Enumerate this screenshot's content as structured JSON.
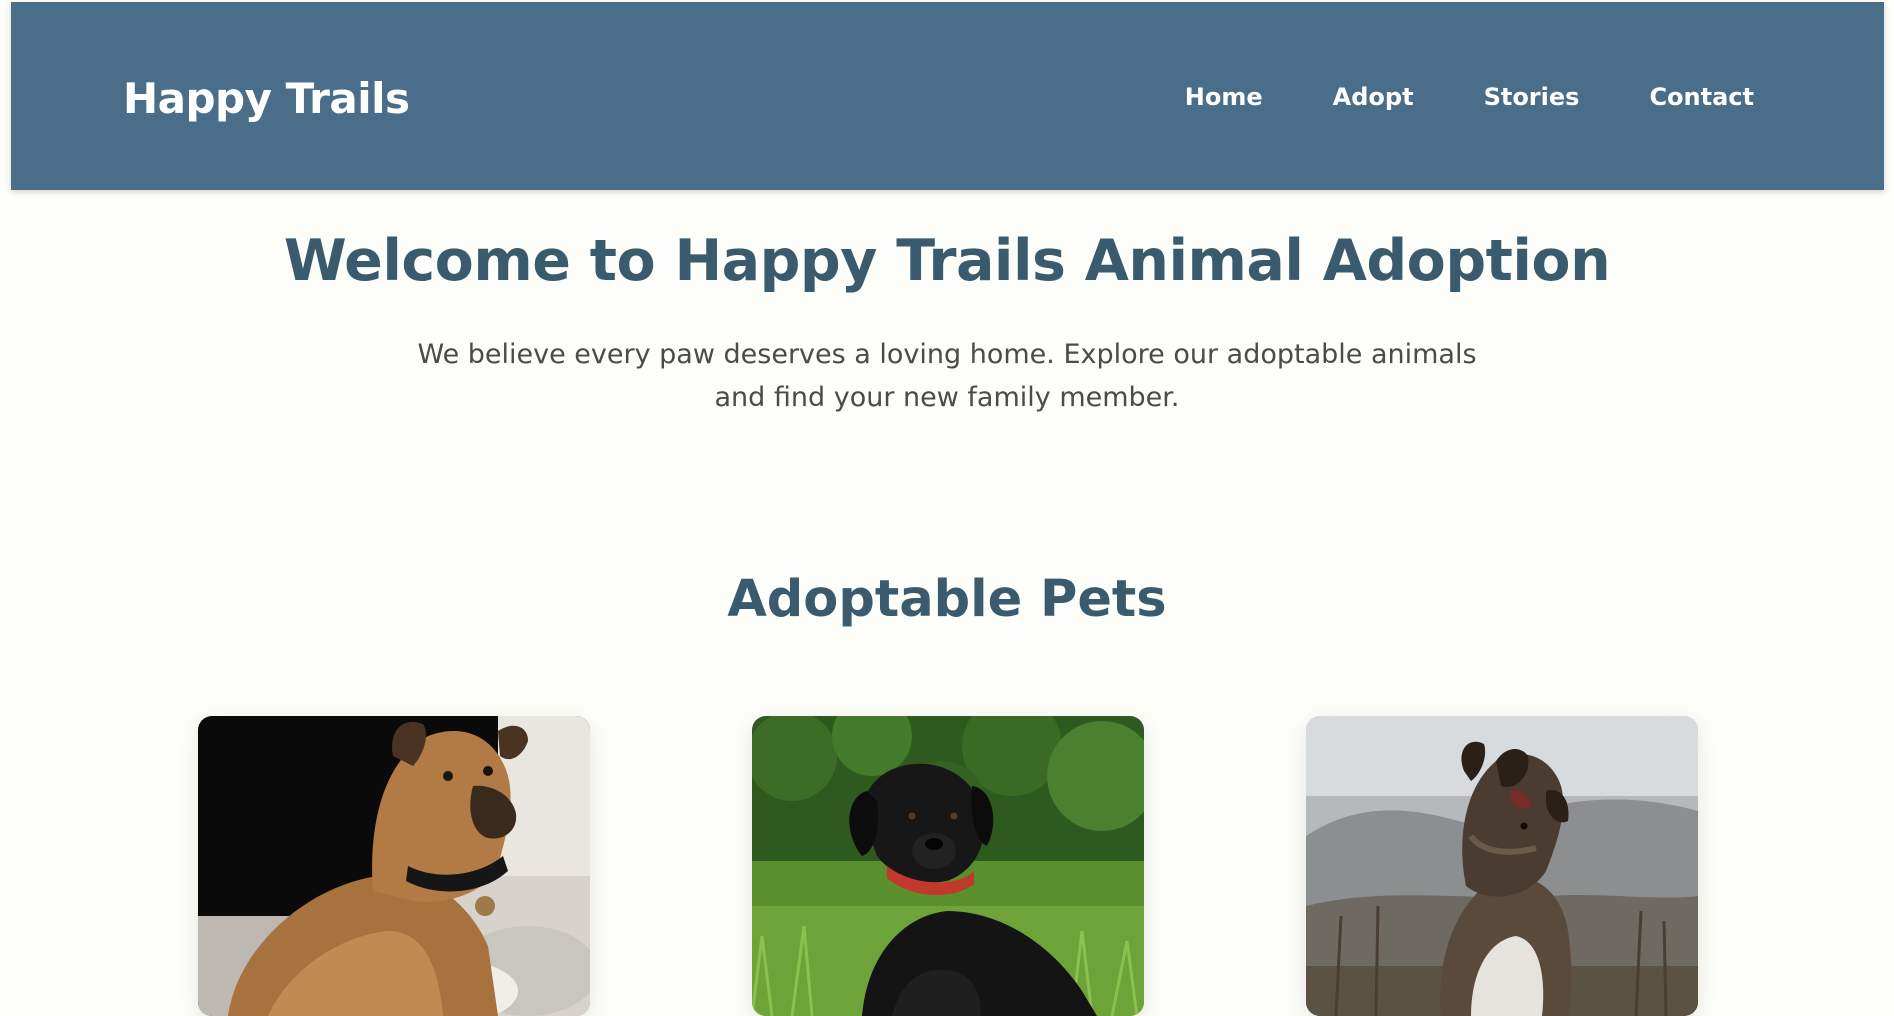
{
  "header": {
    "brand": "Happy Trails",
    "nav": [
      {
        "label": "Home"
      },
      {
        "label": "Adopt"
      },
      {
        "label": "Stories"
      },
      {
        "label": "Contact"
      }
    ]
  },
  "hero": {
    "title": "Welcome to Happy Trails Animal Adoption",
    "subtitle": "We believe every paw deserves a loving home. Explore our adoptable animals and find your new family member."
  },
  "pets_section": {
    "title": "Adoptable Pets",
    "pets": [
      {
        "image": "tan-dog-photo"
      },
      {
        "image": "black-lab-photo"
      },
      {
        "image": "brindle-dog-photo"
      }
    ]
  },
  "colors": {
    "header_bg": "#4a6e89",
    "heading": "#3a5a6e",
    "page_bg": "#fdfdf9",
    "body_text": "#4b4b4b"
  }
}
